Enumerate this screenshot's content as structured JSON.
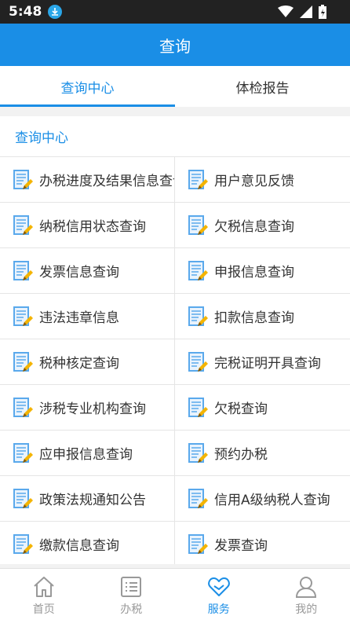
{
  "status": {
    "time": "5:48"
  },
  "app": {
    "title": "查询"
  },
  "tabs": [
    {
      "label": "查询中心",
      "active": true
    },
    {
      "label": "体检报告",
      "active": false
    }
  ],
  "section": {
    "title": "查询中心"
  },
  "items": [
    {
      "label": "办税进度及结果信息查询"
    },
    {
      "label": "用户意见反馈"
    },
    {
      "label": "纳税信用状态查询"
    },
    {
      "label": "欠税信息查询"
    },
    {
      "label": "发票信息查询"
    },
    {
      "label": "申报信息查询"
    },
    {
      "label": "违法违章信息"
    },
    {
      "label": "扣款信息查询"
    },
    {
      "label": "税种核定查询"
    },
    {
      "label": "完税证明开具查询"
    },
    {
      "label": "涉税专业机构查询"
    },
    {
      "label": "欠税查询"
    },
    {
      "label": "应申报信息查询"
    },
    {
      "label": "预约办税"
    },
    {
      "label": "政策法规通知公告"
    },
    {
      "label": "信用A级纳税人查询"
    },
    {
      "label": "缴款信息查询"
    },
    {
      "label": "发票查询"
    }
  ],
  "nav": [
    {
      "label": "首页",
      "icon": "home-icon",
      "active": false
    },
    {
      "label": "办税",
      "icon": "list-icon",
      "active": false
    },
    {
      "label": "服务",
      "icon": "heart-icon",
      "active": true
    },
    {
      "label": "我的",
      "icon": "user-icon",
      "active": false
    }
  ],
  "colors": {
    "primary": "#1a8ee6",
    "status_bar": "#222222",
    "download_badge": "#2aa6e8"
  }
}
